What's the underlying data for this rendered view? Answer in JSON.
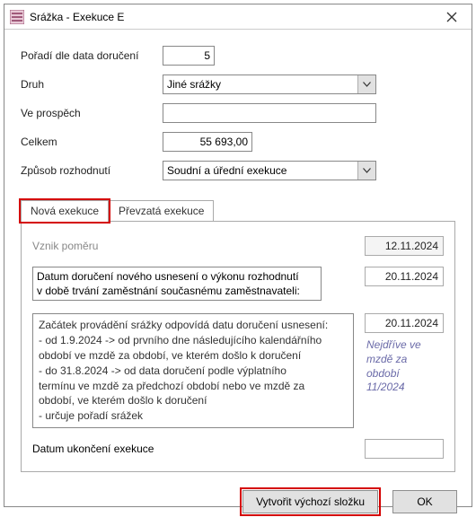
{
  "window": {
    "title": "Srážka - Exekuce E"
  },
  "form": {
    "poradi_label": "Pořadí dle data doručení",
    "poradi_value": "5",
    "druh_label": "Druh",
    "druh_value": "Jiné srážky",
    "veprospech_label": "Ve prospěch",
    "veprospech_value": "",
    "celkem_label": "Celkem",
    "celkem_value": "55 693,00",
    "zpusob_label": "Způsob rozhodnutí",
    "zpusob_value": "Soudní a úřední exekuce"
  },
  "tabs": {
    "nova": "Nová exekuce",
    "prevzata": "Převzatá exekuce"
  },
  "panel": {
    "vznik_label": "Vznik poměru",
    "vznik_date": "12.11.2024",
    "doruceni_label_l1": "Datum doručení nového usnesení o výkonu rozhodnutí",
    "doruceni_label_l2": "v době trvání zaměstnání současnému zaměstnavateli:",
    "doruceni_date": "20.11.2024",
    "desc_l1": "Začátek provádění srážky odpovídá datu doručení usnesení:",
    "desc_l2": "- od 1.9.2024 -> od prvního dne následujícího kalendářního",
    "desc_l3": "období ve mzdě za období, ve kterém došlo k doručení",
    "desc_l4": "- do 31.8.2024 -> od data doručení podle výplatního",
    "desc_l5": "termínu ve mzdě za předchozí období nebo ve mzdě za",
    "desc_l6": "období, ve kterém došlo k doručení",
    "desc_l7": "- určuje pořadí srážek",
    "right_date": "20.11.2024",
    "hint_l1": "Nejdříve ve",
    "hint_l2": "mzdě za období",
    "hint_l3": "11/2024",
    "ukonceni_label": "Datum ukončení exekuce",
    "ukonceni_value": ""
  },
  "footer": {
    "create": "Vytvořit výchozí složku",
    "ok": "OK"
  }
}
